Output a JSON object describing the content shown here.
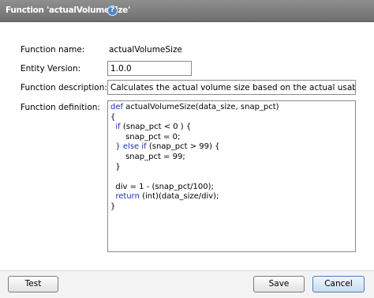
{
  "dialog": {
    "title": "Function 'actualVolumeSize'",
    "help_icon": "question-circle-icon"
  },
  "form": {
    "name_label": "Function name:",
    "name_value": "actualVolumeSize",
    "version_label": "Entity Version:",
    "version_value": "1.0.0",
    "description_label": "Function description:",
    "description_value": "Calculates the actual volume size based on the actual usable size and",
    "definition_label": "Function definition:"
  },
  "code": {
    "lines": [
      {
        "kw": "def",
        "rest": " actualVolumeSize(data_size, snap_pct)"
      },
      {
        "kw": "",
        "rest": "{"
      },
      {
        "kw": "  if",
        "rest": " (snap_pct < 0 ) {"
      },
      {
        "kw": "",
        "rest": "      snap_pct = 0;"
      },
      {
        "kw": "  } else if",
        "rest": " (snap_pct > 99) {"
      },
      {
        "kw": "",
        "rest": "      snap_pct = 99;"
      },
      {
        "kw": "",
        "rest": "  }"
      },
      {
        "kw": "",
        "rest": ""
      },
      {
        "kw": "",
        "rest": "  div = 1 - (snap_pct/100);"
      },
      {
        "kw": "  return",
        "rest": " (int)(data_size/div);"
      },
      {
        "kw": "",
        "rest": "}"
      }
    ]
  },
  "buttons": {
    "test": "Test",
    "save": "Save",
    "cancel": "Cancel"
  },
  "colors": {
    "titlebar": "#7f7f7f",
    "keyword": "#1a2fb0",
    "primary_button": "#c9ddf1"
  }
}
